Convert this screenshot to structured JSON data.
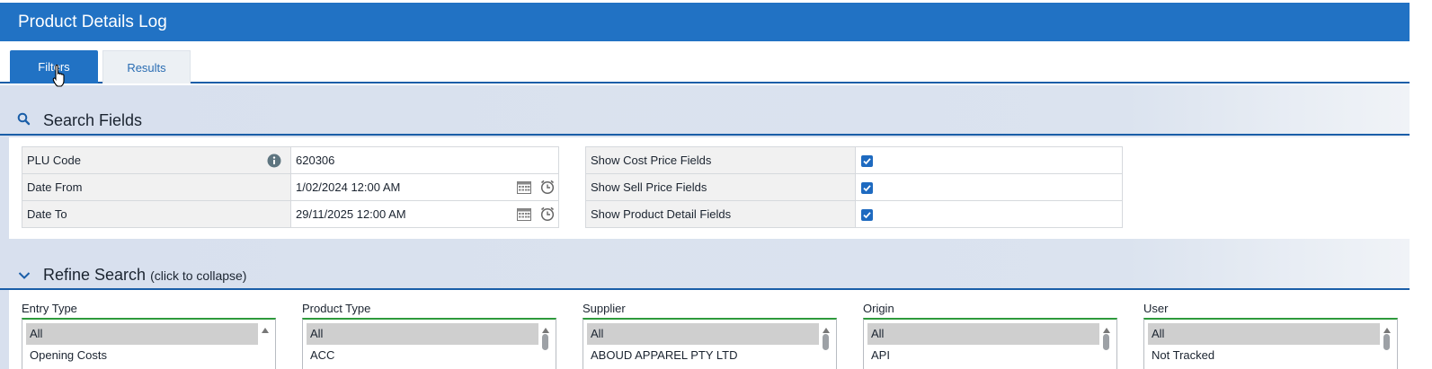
{
  "app": {
    "title": "Product Details Log"
  },
  "tabs": [
    {
      "label": "Filters"
    },
    {
      "label": "Results"
    }
  ],
  "search_fields": {
    "title": "Search Fields",
    "plu_code": {
      "label": "PLU Code",
      "value": "620306"
    },
    "date_from": {
      "label": "Date From",
      "value": "1/02/2024 12:00 AM"
    },
    "date_to": {
      "label": "Date To",
      "value": "29/11/2025 12:00 AM"
    },
    "options": [
      {
        "label": "Show Cost Price Fields",
        "checked": true
      },
      {
        "label": "Show Sell Price Fields",
        "checked": true
      },
      {
        "label": "Show Product Detail Fields",
        "checked": true
      }
    ]
  },
  "refine_search": {
    "title": "Refine Search",
    "subtitle": "(click to collapse)",
    "lists": [
      {
        "label": "Entry Type",
        "selected": "All",
        "next": "Opening Costs"
      },
      {
        "label": "Product Type",
        "selected": "All",
        "next": "ACC"
      },
      {
        "label": "Supplier",
        "selected": "All",
        "next": "ABOUD APPAREL PTY LTD"
      },
      {
        "label": "Origin",
        "selected": "All",
        "next": "API"
      },
      {
        "label": "User",
        "selected": "All",
        "next": "Not Tracked"
      }
    ]
  },
  "colors": {
    "brand_blue": "#2172c4",
    "accent_green": "#2e9a3c",
    "checkbox_blue": "#1e6ac0"
  },
  "icons": [
    "search-icon",
    "chevron-down-icon",
    "info-icon",
    "calendar-icon",
    "clock-icon",
    "hand-pointer-icon"
  ]
}
